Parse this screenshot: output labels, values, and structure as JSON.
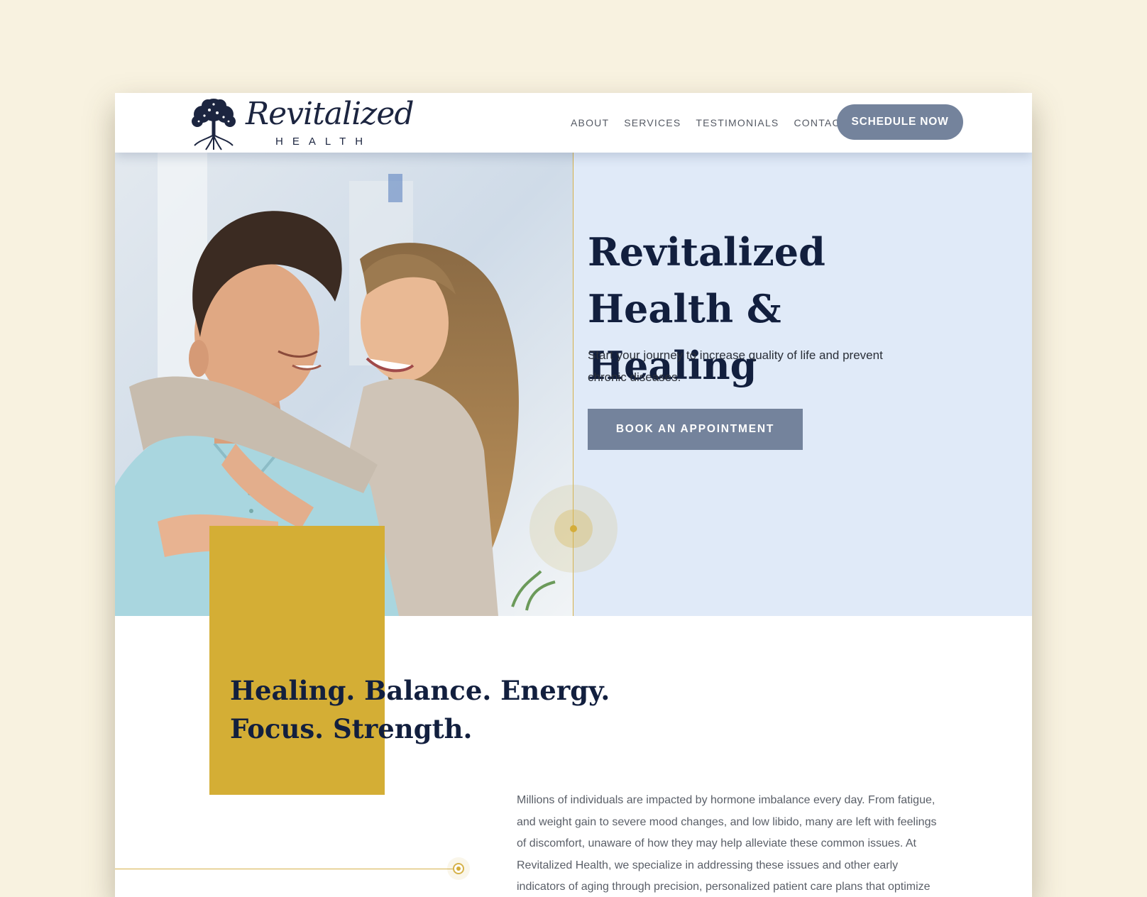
{
  "brand": {
    "logo_script": "Revitalized",
    "logo_sub": "HEALTH",
    "logo_icon": "tree-of-life-icon"
  },
  "nav": {
    "items": [
      {
        "label": "ABOUT"
      },
      {
        "label": "SERVICES"
      },
      {
        "label": "TESTIMONIALS"
      },
      {
        "label": "CONTACT"
      }
    ],
    "cta_label": "SCHEDULE NOW"
  },
  "hero": {
    "title_line1": "Revitalized",
    "title_line2": "Health & Healing",
    "subtitle": "Start your journey to increase quality of life and prevent chronic diseases.",
    "cta_label": "BOOK AN APPOINTMENT"
  },
  "intro": {
    "tagline_line1": "Healing. Balance. Energy.",
    "tagline_line2": "Focus. Strength.",
    "body": "Millions of individuals are impacted by hormone imbalance every day. From fatigue, and weight gain to severe mood changes, and low libido, many are left with feelings of discomfort, unaware of how they may help alleviate these common issues. At Revitalized Health, we specialize in addressing these issues and other early indicators of aging through precision, personalized patient care plans that optimize"
  },
  "colors": {
    "page_bg": "#f8f2e0",
    "navy": "#121f3e",
    "slate_button": "#74839c",
    "hero_bg": "#e0eaf8",
    "gold": "#d4ae35"
  }
}
